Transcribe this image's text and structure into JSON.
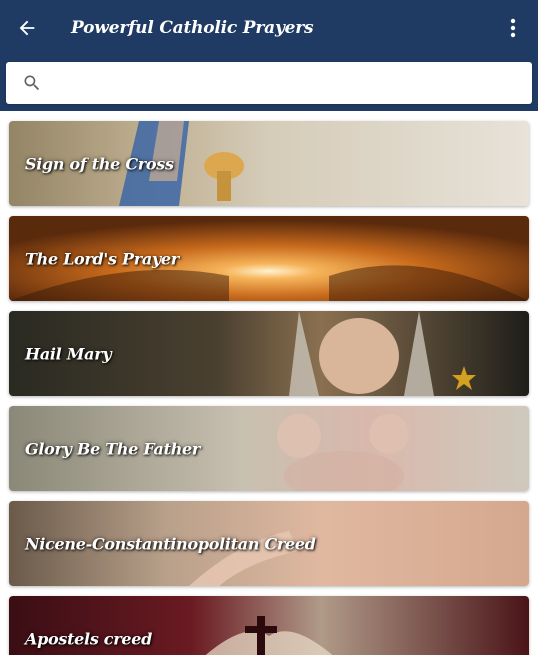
{
  "appbar": {
    "title": "Powerful Catholic Prayers",
    "back_icon": "arrow-back-icon",
    "menu_icon": "more-vert-icon",
    "color": "#1f3a63"
  },
  "search": {
    "placeholder": "",
    "value": "",
    "icon": "search-icon"
  },
  "prayers": [
    {
      "title": "Sign of the Cross"
    },
    {
      "title": "The Lord's Prayer"
    },
    {
      "title": "Hail Mary"
    },
    {
      "title": "Glory Be The Father"
    },
    {
      "title": "Nicene-Constantinopolitan Creed"
    },
    {
      "title": "Apostels creed"
    }
  ]
}
